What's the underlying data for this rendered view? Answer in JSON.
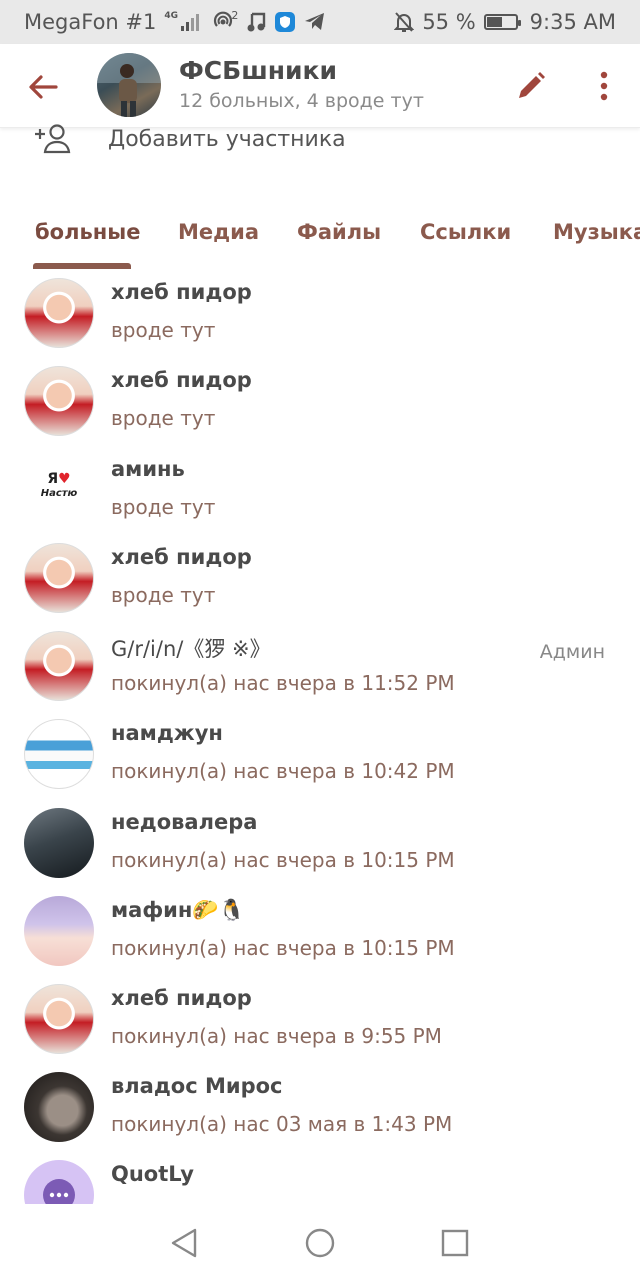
{
  "status_bar": {
    "carrier": "MegaFon #1",
    "net_small": "4G",
    "hotspot_count": "2",
    "battery_text": "55 %",
    "battery_level": 0.55,
    "time": "9:35 AM"
  },
  "header": {
    "title": "ФСБшники",
    "subtitle": "12 больных, 4 вроде тут",
    "icons": [
      "arrow-back-icon",
      "pencil-icon",
      "more-vert-icon"
    ]
  },
  "add_member": {
    "label": "Добавить участника"
  },
  "tabs": [
    {
      "label": "больные",
      "active": true
    },
    {
      "label": "Медиа"
    },
    {
      "label": "Файлы"
    },
    {
      "label": "Ссылки"
    },
    {
      "label": "Музыка"
    }
  ],
  "members": [
    {
      "name": "хлеб пидор",
      "status": "вроде тут",
      "role": ""
    },
    {
      "name": "хлеб пидор",
      "status": "вроде тут",
      "role": ""
    },
    {
      "name": "аминь",
      "status": "вроде тут",
      "role": "",
      "avatar_text": "Я",
      "avatar_text2": "Настю"
    },
    {
      "name": "хлеб пидор",
      "status": "вроде тут",
      "role": ""
    },
    {
      "name": "G/r/i/n/《猡 ※》",
      "status": "покинул(а) нас  вчера в 11:52 PM",
      "role": "Админ"
    },
    {
      "name": "намджун",
      "status": "покинул(а) нас  вчера в 10:42 PM",
      "role": ""
    },
    {
      "name": "недовалера",
      "status": "покинул(а) нас  вчера в 10:15 PM",
      "role": ""
    },
    {
      "name": "мафин🌮🐧",
      "status": "покинул(а) нас  вчера в 10:15 PM",
      "role": ""
    },
    {
      "name": "хлеб пидор",
      "status": "покинул(а) нас  вчера в 9:55 PM",
      "role": ""
    },
    {
      "name": "владос Мирос",
      "status": "покинул(а) нас  03 мая в 1:43 PM",
      "role": ""
    },
    {
      "name": "QuotLy",
      "status": "",
      "role": ""
    }
  ],
  "colors": {
    "accent": "#8b5a4d",
    "icon": "#a0463c",
    "status_bar_bg": "#e9e9e9"
  }
}
